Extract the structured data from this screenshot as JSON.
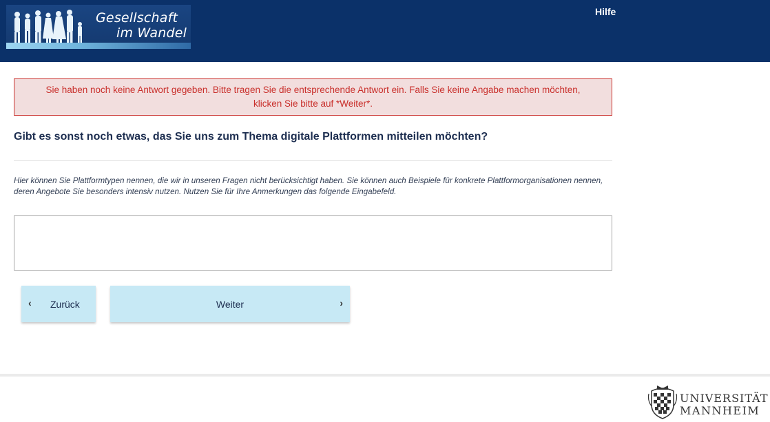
{
  "header": {
    "logo_line1": "Gesellschaft",
    "logo_line2": "im Wandel",
    "help_label": "Hilfe"
  },
  "alert": {
    "line1": "Sie haben noch keine Antwort gegeben. Bitte tragen Sie die entsprechende Antwort ein. Falls Sie keine Angabe machen möchten,",
    "line2": "klicken Sie bitte auf *Weiter*."
  },
  "question": {
    "title": "Gibt es sonst noch etwas, das Sie uns zum Thema digitale Plattformen mitteilen möchten?",
    "hint": "Hier können Sie Plattformtypen nennen, die wir in unseren Fragen nicht berücksichtigt haben. Sie können auch Beispiele für konkrete Plattformorganisationen nennen, deren Angebote Sie besonders intensiv nutzen. Nutzen Sie für Ihre Anmerkungen das folgende Eingabefeld.",
    "answer_value": ""
  },
  "navigation": {
    "back_label": "Zurück",
    "next_label": "Weiter",
    "back_icon": "chevron-left-icon",
    "next_icon": "chevron-right-icon"
  },
  "footer": {
    "university_line1": "UNIVERSITÄT",
    "university_line2": "MANNHEIM"
  },
  "colors": {
    "header_bg": "#0b3169",
    "alert_bg": "#f2dede",
    "alert_text": "#c9302c",
    "button_bg": "#c7e9f5"
  }
}
